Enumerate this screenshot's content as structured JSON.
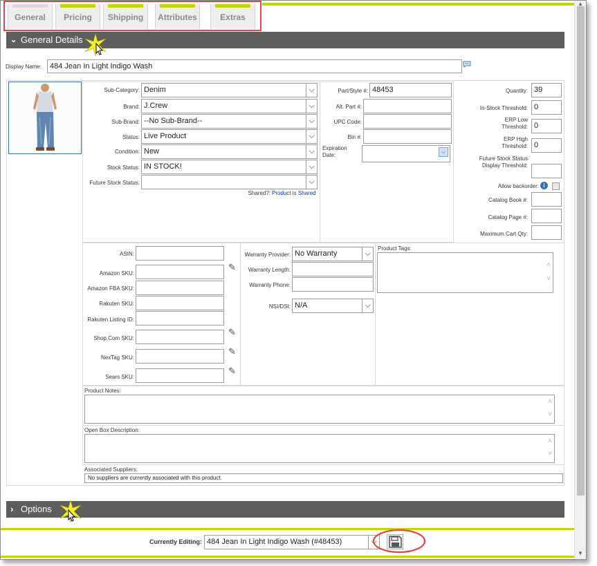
{
  "tabs": [
    "General",
    "Pricing",
    "Shipping",
    "Attributes",
    "Extras"
  ],
  "sections": {
    "general_details": "General Details",
    "options": "Options"
  },
  "display_name": {
    "label": "Display Name:",
    "value": "484 Jean In Light Indigo Wash"
  },
  "left_fields": [
    {
      "label": "Sub-Category:",
      "value": "Denim"
    },
    {
      "label": "Brand:",
      "value": "J.Crew"
    },
    {
      "label": "Sub-Brand:",
      "value": "--No Sub-Brand--"
    },
    {
      "label": "Status:",
      "value": "Live Product"
    },
    {
      "label": "Condition:",
      "value": "New"
    },
    {
      "label": "Stock Status:",
      "value": "IN STOCK!"
    },
    {
      "label": "Future Stock Status:",
      "value": ""
    }
  ],
  "shared": {
    "label": "Shared?:",
    "value": "Product is Shared"
  },
  "mid_fields": [
    {
      "label": "Part/Style #:",
      "value": "48453"
    },
    {
      "label": "Alt. Part #:",
      "value": ""
    },
    {
      "label": "UPC Code:",
      "value": ""
    },
    {
      "label": "Bin #:",
      "value": ""
    }
  ],
  "expiration": {
    "label": "Expiration Date:",
    "value": ""
  },
  "right_fields": [
    {
      "label": "Quantity:",
      "value": "39"
    },
    {
      "label": "In-Stock Threshold:",
      "value": "0"
    },
    {
      "label": "ERP Low Threshold:",
      "value": "0"
    },
    {
      "label": "ERP High Threshold:",
      "value": "0"
    },
    {
      "label": "Future Stock Status Display Threshold:",
      "value": ""
    }
  ],
  "allow_backorder": {
    "label": "Allow backorder:",
    "checked": false
  },
  "right_fields2": [
    {
      "label": "Catalog Book #:",
      "value": ""
    },
    {
      "label": "Catalog Page #:",
      "value": ""
    },
    {
      "label": "Maximum Cart Qty:",
      "value": ""
    }
  ],
  "marketplace": [
    {
      "label": "ASIN:",
      "value": ""
    },
    {
      "label": "Amazon SKU:",
      "value": ""
    },
    {
      "label": "Amazon FBA SKU:",
      "value": ""
    },
    {
      "label": "Rakuten SKU:",
      "value": ""
    },
    {
      "label": "Rakuten Listing ID:",
      "value": ""
    },
    {
      "label": "Shop.Com SKU:",
      "value": ""
    },
    {
      "label": "NexTag SKU:",
      "value": ""
    },
    {
      "label": "Sears SKU:",
      "value": ""
    }
  ],
  "warranty": {
    "provider_label": "Warranty Provider:",
    "provider": "No Warranty",
    "length_label": "Warranty Length:",
    "length": "",
    "phone_label": "Warranty Phone:",
    "phone": "",
    "nsi_label": "NSI/DSI:",
    "nsi": "N/A"
  },
  "tags_label": "Product Tags:",
  "notes_label": "Product Notes:",
  "openbox_label": "Open Box Description:",
  "suppliers": {
    "label": "Associated Suppliers:",
    "value": "No suppliers are currently associated with this product."
  },
  "footer": {
    "label": "Currently Editing:",
    "value": "484 Jean In Light Indigo Wash (#48453)"
  },
  "colors": {
    "accent": "#c3d600",
    "bar": "#5e5e5e",
    "highlight": "#e04848",
    "link": "#0033cc"
  }
}
